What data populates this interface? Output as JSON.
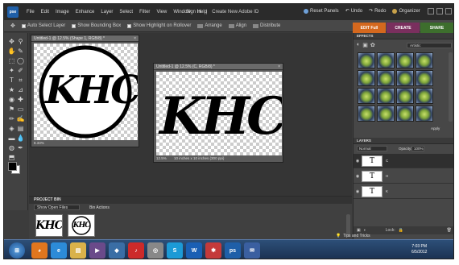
{
  "app": {
    "logo": "pse"
  },
  "menubar": {
    "items": [
      "File",
      "Edit",
      "Image",
      "Enhance",
      "Layer",
      "Select",
      "Filter",
      "View",
      "Window",
      "Help"
    ],
    "sign_in": "Sign In",
    "create_id": "Create New Adobe ID",
    "reset_panels": "Reset Panels",
    "undo": "Undo",
    "redo": "Redo",
    "organizer": "Organizer"
  },
  "options": {
    "auto_select": "Auto Select Layer",
    "show_bounding": "Show Bounding Box",
    "show_highlight": "Show Highlight on Rollover",
    "arrange": "Arrange",
    "align": "Align",
    "distribute": "Distribute"
  },
  "modes": {
    "edit_full": "EDIT Full",
    "create": "CREATE",
    "share": "SHARE"
  },
  "docs": {
    "doc1_title": "Untitled-1 @ 12.5% (Shape 1, RGB/8) *",
    "doc1_zoom": "8.33%",
    "doc2_title": "Untitled-1 @ 12.5% (C, RGB/8) *",
    "doc2_zoom": "12.5%",
    "doc2_info": "10 inches x 10 inches (300 ppi)",
    "monogram": "KHC"
  },
  "bin": {
    "title": "PROJECT BIN",
    "show": "Show Open Files",
    "actions": "Bin Actions"
  },
  "effects": {
    "title": "EFFECTS",
    "category": "Artistic",
    "apply": "Apply"
  },
  "layers": {
    "title": "LAYERS",
    "mode": "Normal",
    "opacity_label": "Opacity:",
    "opacity_value": "100%",
    "lock_label": "Lock:",
    "items": [
      {
        "glyph": "T",
        "name": "C"
      },
      {
        "glyph": "T",
        "name": "H"
      },
      {
        "glyph": "T",
        "name": "K"
      }
    ]
  },
  "statusbar": {
    "tips": "Tips and Tricks"
  },
  "taskbar": {
    "time": "7:03 PM",
    "date": "6/5/2012"
  },
  "colors": {
    "edit": "#d4681e",
    "create": "#7a2f5e",
    "share": "#3d6e2d"
  }
}
